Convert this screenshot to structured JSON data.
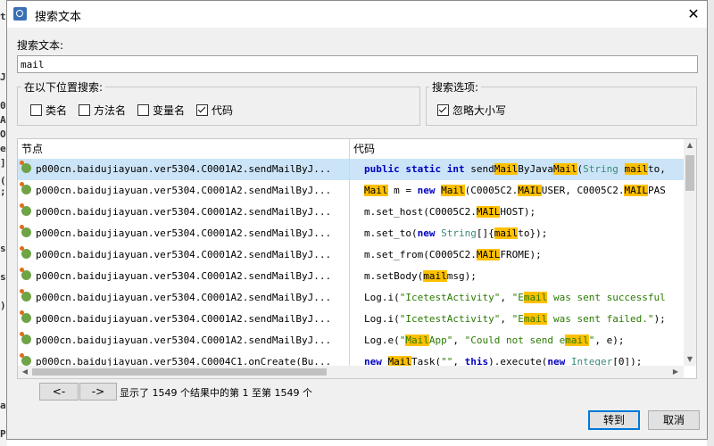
{
  "background": {
    "left_chars": [
      "t",
      "J",
      "0",
      "A",
      "O",
      "e",
      "]",
      "(",
      ";",
      "s",
      "s",
      ")",
      "a",
      "P"
    ]
  },
  "dialog": {
    "title": "搜索文本",
    "close_glyph": "✕",
    "search_label": "搜索文本:",
    "search_value": "mail",
    "location_group": {
      "title": "在以下位置搜索:",
      "options": [
        {
          "label": "类名",
          "checked": false
        },
        {
          "label": "方法名",
          "checked": false
        },
        {
          "label": "变量名",
          "checked": false
        },
        {
          "label": "代码",
          "checked": true
        }
      ]
    },
    "options_group": {
      "title": "搜索选项:",
      "options": [
        {
          "label": "忽略大小写",
          "checked": true
        }
      ]
    },
    "results": {
      "columns": [
        "节点",
        "代码"
      ],
      "nodes": [
        "p000cn.baidujiayuan.ver5304.C0001A2.sendMailByJ...",
        "p000cn.baidujiayuan.ver5304.C0001A2.sendMailByJ...",
        "p000cn.baidujiayuan.ver5304.C0001A2.sendMailByJ...",
        "p000cn.baidujiayuan.ver5304.C0001A2.sendMailByJ...",
        "p000cn.baidujiayuan.ver5304.C0001A2.sendMailByJ...",
        "p000cn.baidujiayuan.ver5304.C0001A2.sendMailByJ...",
        "p000cn.baidujiayuan.ver5304.C0001A2.sendMailByJ...",
        "p000cn.baidujiayuan.ver5304.C0001A2.sendMailByJ...",
        "p000cn.baidujiayuan.ver5304.C0001A2.sendMailByJ...",
        "p000cn.baidujiayuan.ver5304.C0004C1.onCreate(Bu..."
      ],
      "code_lines": [
        "public static int sendMailByJavaMail(String mailto,",
        "Mail m = new Mail(C0005C2.MAILUSER, C0005C2.MAILPAS",
        "m.set_host(C0005C2.MAILHOST);",
        "m.set_to(new String[]{mailto});",
        "m.set_from(C0005C2.MAILFROME);",
        "m.setBody(mailmsg);",
        "Log.i(\"IcetestActivity\", \"Email was sent successful",
        "Log.i(\"IcetestActivity\", \"Email was sent failed.\");",
        "Log.e(\"MailApp\", \"Could not send email\", e);",
        "new MailTask(\"\", this).execute(new Integer[0]);"
      ],
      "selected_index": 0
    },
    "prev_label": "<-",
    "next_label": "->",
    "status_text": "显示了 1549 个结果中的第 1 至第 1549 个",
    "goto_label": "转到",
    "cancel_label": "取消"
  },
  "colors": {
    "highlight": "#ffc000",
    "selection": "#cce4f7",
    "keyword": "#0000c0",
    "type": "#3a8a7a",
    "string": "#2a7a00"
  }
}
